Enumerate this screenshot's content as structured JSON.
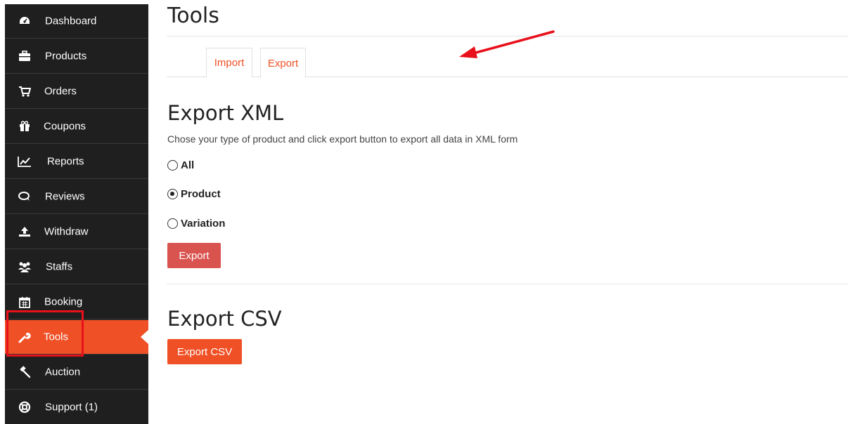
{
  "sidebar": {
    "items": [
      {
        "label": "Dashboard",
        "icon": "dashboard-icon"
      },
      {
        "label": "Products",
        "icon": "briefcase-icon"
      },
      {
        "label": "Orders",
        "icon": "cart-icon"
      },
      {
        "label": "Coupons",
        "icon": "gift-icon"
      },
      {
        "label": "Reports",
        "icon": "line-chart-icon"
      },
      {
        "label": "Reviews",
        "icon": "comments-icon"
      },
      {
        "label": "Withdraw",
        "icon": "upload-icon"
      },
      {
        "label": "Staffs",
        "icon": "users-icon"
      },
      {
        "label": "Booking",
        "icon": "calendar-icon"
      },
      {
        "label": "Tools",
        "icon": "wrench-icon",
        "active": true
      },
      {
        "label": "Auction",
        "icon": "gavel-icon"
      },
      {
        "label": "Support (1)",
        "icon": "life-ring-icon"
      }
    ],
    "active_color": "#f05025",
    "bg_color": "#1f1f1f"
  },
  "main": {
    "title": "Tools",
    "tabs": [
      {
        "label": "Import"
      },
      {
        "label": "Export",
        "active": true
      }
    ],
    "export_xml": {
      "heading": "Export XML",
      "description": "Chose your type of product and click export button to export all data in XML form",
      "options": [
        {
          "label": "All",
          "checked": false
        },
        {
          "label": "Product",
          "checked": true
        },
        {
          "label": "Variation",
          "checked": false
        }
      ],
      "button_label": "Export",
      "button_color": "#d9534f"
    },
    "export_csv": {
      "heading": "Export CSV",
      "button_label": "Export CSV",
      "button_color": "#f05025"
    }
  },
  "annotations": {
    "arrow_color": "#e8101a",
    "box_color": "#e8101a"
  }
}
